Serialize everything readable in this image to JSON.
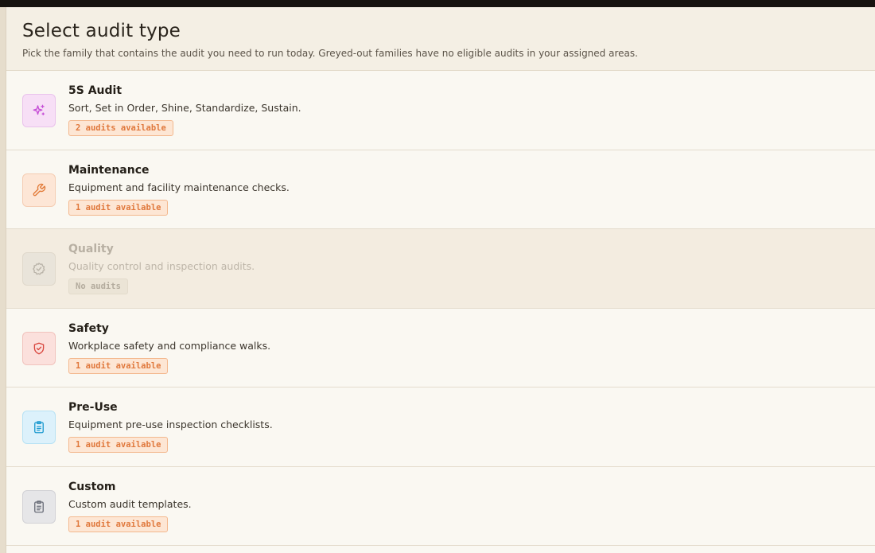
{
  "header": {
    "title": "Select audit type",
    "subtitle": "Pick the family that contains the audit you need to run today. Greyed-out families have no eligible audits in your assigned areas."
  },
  "families": [
    {
      "name": "5S Audit",
      "description": "Sort, Set in Order, Shine, Standardize, Sustain.",
      "badge": "2 audits available",
      "icon": "sparkles-icon",
      "color": "#c64fd6",
      "bg": "#f7dff6",
      "border": "#e9c3ec",
      "disabled": false
    },
    {
      "name": "Maintenance",
      "description": "Equipment and facility maintenance checks.",
      "badge": "1 audit available",
      "icon": "wrench-icon",
      "color": "#e27a38",
      "bg": "#fde6d6",
      "border": "#f5cdb3",
      "disabled": false
    },
    {
      "name": "Quality",
      "description": "Quality control and inspection audits.",
      "badge": "No audits",
      "icon": "badge-check-icon",
      "color": "#b8b2a7",
      "bg": "#e9e4da",
      "border": "#e0d9cc",
      "disabled": true
    },
    {
      "name": "Safety",
      "description": "Workplace safety and compliance walks.",
      "badge": "1 audit available",
      "icon": "shield-check-icon",
      "color": "#d9473f",
      "bg": "#fbe0dc",
      "border": "#f1c3bd",
      "disabled": false
    },
    {
      "name": "Pre-Use",
      "description": "Equipment pre-use inspection checklists.",
      "badge": "1 audit available",
      "icon": "clipboard-list-icon",
      "color": "#1f9bd0",
      "bg": "#dcf1fb",
      "border": "#b8e2f4",
      "disabled": false
    },
    {
      "name": "Custom",
      "description": "Custom audit templates.",
      "badge": "1 audit available",
      "icon": "clipboard-icon",
      "color": "#6b6f7a",
      "bg": "#e6e6e8",
      "border": "#d2d2d6",
      "disabled": false
    }
  ]
}
